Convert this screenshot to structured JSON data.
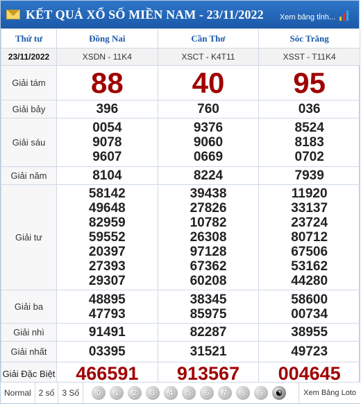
{
  "header": {
    "title": "KẾT QUẢ XỔ SỐ MIỀN NAM - 23/11/2022",
    "view_link": "Xem bảng tỉnh..."
  },
  "table": {
    "weekday": "Thứ tư",
    "date": "23/11/2022",
    "provinces": [
      {
        "name": "Đồng Nai",
        "code": "XSDN - 11K4"
      },
      {
        "name": "Cần Thơ",
        "code": "XSCT - K4T11"
      },
      {
        "name": "Sóc Trăng",
        "code": "XSST - T11K4"
      }
    ],
    "prizes": [
      {
        "label": "Giải tám",
        "values": [
          [
            "88"
          ],
          [
            "40"
          ],
          [
            "95"
          ]
        ]
      },
      {
        "label": "Giải bảy",
        "values": [
          [
            "396"
          ],
          [
            "760"
          ],
          [
            "036"
          ]
        ]
      },
      {
        "label": "Giải sáu",
        "values": [
          [
            "0054",
            "9078",
            "9607"
          ],
          [
            "9376",
            "9060",
            "0669"
          ],
          [
            "8524",
            "8183",
            "0702"
          ]
        ]
      },
      {
        "label": "Giải năm",
        "values": [
          [
            "8104"
          ],
          [
            "8224"
          ],
          [
            "7939"
          ]
        ]
      },
      {
        "label": "Giải tư",
        "values": [
          [
            "58142",
            "49648",
            "82959",
            "59552",
            "20397",
            "27393",
            "29307"
          ],
          [
            "39438",
            "27826",
            "10782",
            "26308",
            "97128",
            "67362",
            "60208"
          ],
          [
            "11920",
            "33137",
            "23724",
            "80712",
            "67506",
            "53162",
            "44280"
          ]
        ]
      },
      {
        "label": "Giải ba",
        "values": [
          [
            "48895",
            "47793"
          ],
          [
            "38345",
            "85975"
          ],
          [
            "58600",
            "00734"
          ]
        ]
      },
      {
        "label": "Giải nhì",
        "values": [
          [
            "91491"
          ],
          [
            "82287"
          ],
          [
            "38955"
          ]
        ]
      },
      {
        "label": "Giải nhất",
        "values": [
          [
            "03395"
          ],
          [
            "31521"
          ],
          [
            "49723"
          ]
        ]
      },
      {
        "label": "Giải Đặc Biệt",
        "values": [
          [
            "466591"
          ],
          [
            "913567"
          ],
          [
            "004645"
          ]
        ]
      }
    ]
  },
  "footer": {
    "tabs": [
      "Normal",
      "2 số",
      "3 Số"
    ],
    "balls": [
      "0",
      "1",
      "2",
      "3",
      "4",
      "5",
      "6",
      "7",
      "8",
      "9"
    ],
    "loto_link": "Xem Bảng Loto"
  },
  "colors": {
    "header_bg": "#1b59a8",
    "province_text": "#1b59a8",
    "highlight_number": "#a00000"
  },
  "icons": [
    "envelope-icon",
    "bar-chart-icon",
    "yin-yang-icon"
  ]
}
